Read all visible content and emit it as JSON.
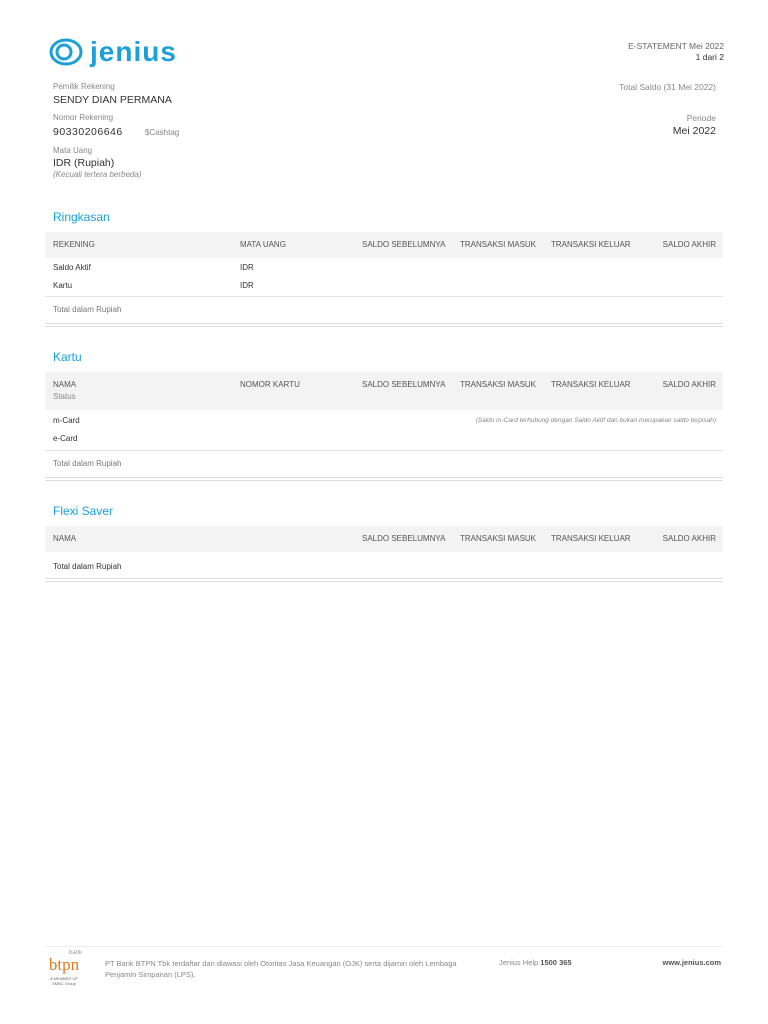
{
  "brand": {
    "name": "Jenius",
    "color": "#1ba0d8"
  },
  "header": {
    "statement": "E-STATEMENT Mei 2022",
    "page": "1 dari 2",
    "total_saldo_label": "Total Saldo (31 Mei 2022)",
    "periode_label": "Periode",
    "periode_value": "Mei 2022"
  },
  "account": {
    "owner_label": "Pemilik Rekening",
    "owner": "SENDY DIAN PERMANA",
    "number_label": "Nomor Rekening",
    "number": "90330206646",
    "cashtag": "$Cashtag",
    "currency_label": "Mata Uang",
    "currency": "IDR (Rupiah)",
    "currency_note": "(Kecuali tertera berbeda)"
  },
  "ringkasan": {
    "title": "Ringkasan",
    "headers": [
      "REKENING",
      "MATA UANG",
      "SALDO SEBELUMNYA",
      "TRANSAKSI MASUK",
      "TRANSAKSI KELUAR",
      "SALDO AKHIR"
    ],
    "rows": [
      {
        "name": "Saldo Aktif",
        "currency": "IDR"
      },
      {
        "name": "Kartu",
        "currency": "IDR"
      }
    ],
    "total": "Total dalam Rupiah"
  },
  "kartu": {
    "title": "Kartu",
    "headers": [
      "NAMA",
      "NOMOR KARTU",
      "SALDO SEBELUMNYA",
      "TRANSAKSI MASUK",
      "TRANSAKSI KELUAR",
      "SALDO AKHIR"
    ],
    "subheader": "Status",
    "rows": [
      {
        "name": "m-Card",
        "note": "(Saldo m-Card terhubung dengan Saldo Aktif dan bukan merupakan saldo terpisah)"
      },
      {
        "name": "e-Card"
      }
    ],
    "total": "Total dalam Rupiah"
  },
  "flexi": {
    "title": "Flexi Saver",
    "headers": [
      "NAMA",
      "SALDO SEBELUMNYA",
      "TRANSAKSI MASUK",
      "TRANSAKSI KELUAR",
      "SALDO AKHIR"
    ],
    "total": "Total dalam Rupiah"
  },
  "footer": {
    "logo_small": "bank",
    "logo": "btpn",
    "logo_sub": "A MEMBER OF SMBC Group",
    "disclaimer": "PT Bank BTPN Tbk terdaftar dan diawasi oleh Otoritas Jasa Keuangan (OJK) serta dijamin oleh Lembaga Penjamin Simpanan (LPS).",
    "help_label": "Jenius Help",
    "help_number": "1500 365",
    "website": "www.jenius.com"
  }
}
